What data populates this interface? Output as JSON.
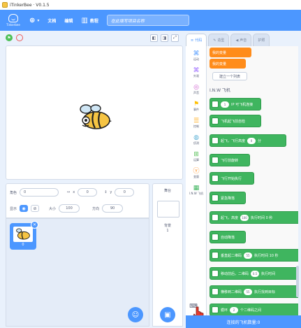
{
  "window": {
    "title": "iTinkerBee · V0.1.5"
  },
  "menubar": {
    "logo_text": "Tinkerbee",
    "items": [
      {
        "label": "",
        "icon": "globe-icon"
      },
      {
        "label": "文档",
        "icon": ""
      },
      {
        "label": "编辑",
        "icon": ""
      },
      {
        "label": "教程",
        "icon": "book-icon"
      }
    ],
    "project_placeholder": "在此填写项目名称"
  },
  "stage": {
    "sprite_icon": "bee-icon"
  },
  "sprite_info": {
    "sprite_label": "角色",
    "sprite_name": "0",
    "x_label": "x",
    "x_value": "0",
    "y_label": "y",
    "y_value": "0",
    "show_label": "显示",
    "size_label": "大小",
    "size_value": "100",
    "direction_label": "方向",
    "direction_value": "90"
  },
  "sprite_list": {
    "items": [
      {
        "name": "0"
      }
    ]
  },
  "stage_pane": {
    "title": "舞台",
    "backdrops_label": "背景",
    "backdrops_count": "1"
  },
  "tabs": [
    {
      "label": "代码",
      "icon": "code-icon"
    },
    {
      "label": "造型",
      "icon": "brush-icon"
    },
    {
      "label": "声音",
      "icon": "speaker-icon"
    },
    {
      "label": "护照",
      "icon": ""
    }
  ],
  "categories": [
    {
      "label": "运动",
      "color": "#4c97ff"
    },
    {
      "label": "外观",
      "color": "#9966ff"
    },
    {
      "label": "声音",
      "color": "#cf63cf"
    },
    {
      "label": "事件",
      "color": "#ffbf00"
    },
    {
      "label": "控制",
      "color": "#ffab19"
    },
    {
      "label": "侦测",
      "color": "#5cb1d6"
    },
    {
      "label": "运算",
      "color": "#59c059"
    },
    {
      "label": "变量",
      "color": "#ff8c1a"
    },
    {
      "label": "I.N.W 飞机",
      "color": "#3fb55f"
    }
  ],
  "palette": {
    "orange_blocks": [
      "我的变量",
      "我的变量"
    ],
    "make_list": "建立一个列表",
    "section_title": "I.N.W 飞机",
    "green_blocks": [
      {
        "text": "IP 可飞机连接",
        "oval": "1"
      },
      {
        "text": "飞机起飞前自检",
        "oval": ""
      },
      {
        "text": "起飞，飞行高度",
        "oval": "0",
        "suffix": "分"
      },
      {
        "text": "飞行前旋转",
        "oval": ""
      },
      {
        "text": "飞行开始执行",
        "oval": ""
      },
      {
        "text": "紧急降落",
        "oval": ""
      },
      {
        "text": "起飞，高度",
        "oval": "100",
        "suffix": "执行时间 0 秒"
      },
      {
        "text": "自动降落",
        "oval": ""
      },
      {
        "text": "垂直起二维码",
        "oval": "55",
        "suffix": "执行时间 10 秒"
      },
      {
        "text": "移动前后，二维码",
        "oval": "0.5",
        "suffix": "执行时间"
      },
      {
        "text": "横移到二维码",
        "oval": "55",
        "suffix": "执行找到目标"
      },
      {
        "text": "循环",
        "oval": "2",
        "suffix": "个二维码之间"
      }
    ]
  },
  "status": {
    "text": "连接的飞机数量:0"
  }
}
